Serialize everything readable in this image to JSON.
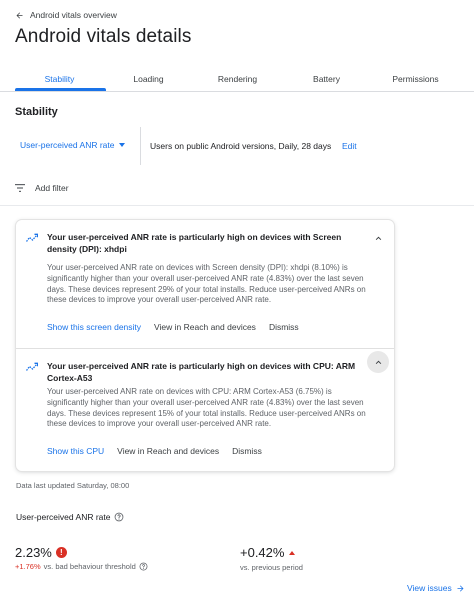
{
  "header": {
    "back_label": "Android vitals overview",
    "title": "Android vitals details"
  },
  "tabs": [
    {
      "label": "Stability",
      "active": true
    },
    {
      "label": "Loading",
      "active": false
    },
    {
      "label": "Rendering",
      "active": false
    },
    {
      "label": "Battery",
      "active": false
    },
    {
      "label": "Permissions",
      "active": false
    }
  ],
  "section": {
    "heading": "Stability"
  },
  "filters": {
    "metric_selected": "User-perceived ANR rate",
    "summary": "Users on public Android versions, Daily, 28 days",
    "edit_label": "Edit",
    "add_filter_label": "Add filter"
  },
  "insights": [
    {
      "title": "Your user-perceived ANR rate is particularly high on devices with Screen density (DPI): xhdpi",
      "body": "Your user-perceived ANR rate on devices with Screen density (DPI): xhdpi (8.10%) is significantly higher than your overall user-perceived ANR rate (4.83%) over the last seven days. These devices represent 29% of your total installs. Reduce user-perceived ANRs on these devices to improve your overall user-perceived ANR rate.",
      "actions": [
        "Show this screen density",
        "View in Reach and devices",
        "Dismiss"
      ]
    },
    {
      "title": "Your user-perceived ANR rate is particularly high on devices with CPU: ARM Cortex-A53",
      "body": "Your user-perceived ANR rate on devices with CPU: ARM Cortex-A53 (6.75%) is significantly higher than your overall user-perceived ANR rate (4.83%) over the last seven days. These devices represent 15% of your total installs. Reduce user-perceived ANRs on these devices to improve your overall user-perceived ANR rate.",
      "actions": [
        "Show this CPU",
        "View in Reach and devices",
        "Dismiss"
      ]
    }
  ],
  "updated_text": "Data last updated Saturday, 08:00",
  "metric": {
    "label": "User-perceived ANR rate",
    "value": "2.23%",
    "threshold_delta": "+1.76%",
    "threshold_text": "vs. bad behaviour threshold",
    "change_value": "+0.42%",
    "change_text": "vs. previous period"
  },
  "view_issues_label": "View issues",
  "colors": {
    "accent": "#1a73e8",
    "error": "#d93025",
    "text": "#202124",
    "muted": "#5f6368"
  }
}
